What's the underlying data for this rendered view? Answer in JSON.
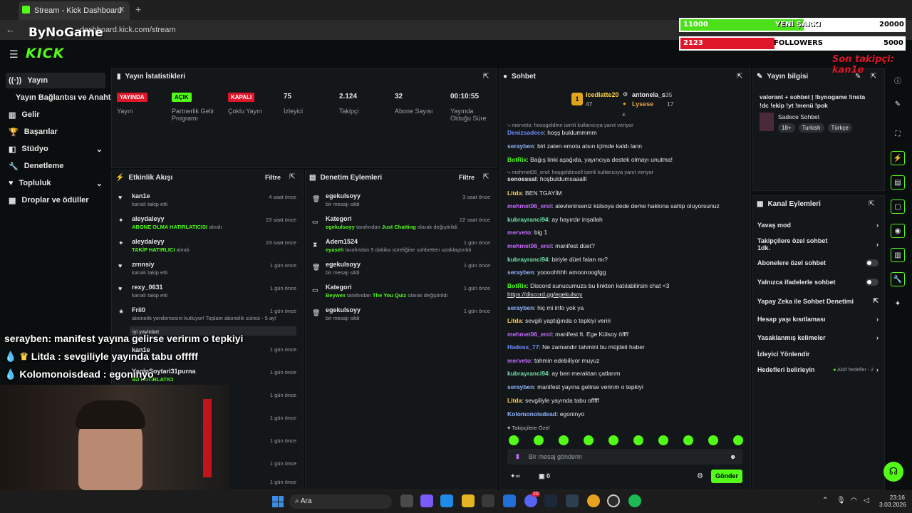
{
  "browser": {
    "tab_title": "Stream - Kick Dashboard",
    "url": "dashboard.kick.com/stream",
    "watermark": "ByNoGame"
  },
  "header": {
    "logo": "KICK"
  },
  "sidebar": {
    "items": [
      {
        "label": "Yayın",
        "icon": "broadcast-icon"
      },
      {
        "label": "Yayın Bağlantısı ve Anahtarı"
      },
      {
        "label": "Gelir",
        "icon": "chart-icon"
      },
      {
        "label": "Başarılar",
        "icon": "trophy-icon"
      },
      {
        "label": "Stüdyo",
        "icon": "layers-icon"
      },
      {
        "label": "Denetleme",
        "icon": "wrench-icon"
      },
      {
        "label": "Topluluk",
        "icon": "heart-icon"
      },
      {
        "label": "Droplar ve ödüller",
        "icon": "grid-icon"
      }
    ]
  },
  "stats": {
    "title": "Yayın İstatistikleri",
    "items": [
      {
        "badge": "YAYINDA",
        "label": "Yayın"
      },
      {
        "badge": "AÇIK",
        "label": "Partnerlik Gelir Programı"
      },
      {
        "badge": "KAPALI",
        "label": "Çoklu Yayın"
      },
      {
        "value": "75",
        "label": "İzleyici"
      },
      {
        "value": "2.124",
        "label": "Takipçi"
      },
      {
        "value": "32",
        "label": "Abone Sayısı"
      },
      {
        "value": "00:10:55",
        "label": "Yayında Olduğu Süre"
      }
    ]
  },
  "activity": {
    "title": "Etkinlik Akışı",
    "filter": "Filtre",
    "rows": [
      {
        "name": "kan1e",
        "sub": "kanalı takip etti",
        "time": "4 saat önce"
      },
      {
        "name": "aleydaleyy",
        "sub_hi": "ABONE OLMA HATIRLATICISI",
        "sub": "alındı",
        "time": "23 saat önce"
      },
      {
        "name": "aleydaleyy",
        "sub_hi": "TAKİP HATIRLICI",
        "sub": "alındı",
        "time": "23 saat önce"
      },
      {
        "name": "zrnnsiy",
        "sub": "kanalı takip etti",
        "time": "1 gün önce"
      },
      {
        "name": "rexy_0631",
        "sub": "kanalı takip etti",
        "time": "1 gün önce"
      },
      {
        "name": "Frii0",
        "sub": "abonelik yenilemesini kutluyor! Toplam abonelik süresi - 5 ay!",
        "time": "1 gün önce"
      },
      {
        "name": "kan1e",
        "sub": "",
        "time": "1 gün önce"
      },
      {
        "name": "YaginSoytari31purna",
        "sub_hi": "SU HATIRLATICI",
        "sub": "",
        "time": "1 gün önce"
      }
    ],
    "extra_times": [
      "1 gün önce",
      "1 gün önce",
      "1 gün önce",
      "1 gün önce",
      "1 gün önce"
    ],
    "tag": "iyi yayinlart"
  },
  "moderation": {
    "title": "Denetim Eylemleri",
    "filter": "Filtre",
    "rows": [
      {
        "name": "egekulsoyy",
        "sub": "bir mesajı sildi",
        "time": "3 saat önce"
      },
      {
        "name": "Kategori",
        "sub_user": "egekulsoyy",
        "sub_mid": "tarafından",
        "sub_hi": "Just Chatting",
        "sub_end": "olarak değiştirildi",
        "time": "22 saat önce"
      },
      {
        "name": "Adem1524",
        "sub_user": "eyaseh",
        "sub_mid": "tarafından 5 dakika süreliğine sohbetten uzaklaştırıldı",
        "time": "1 gün önce"
      },
      {
        "name": "egekulsoyy",
        "sub": "bir mesajı sildi",
        "time": "1 gün önce"
      },
      {
        "name": "Kategori",
        "sub_user": "Beywex",
        "sub_mid": "tarafından",
        "sub_hi": "The You Quiz",
        "sub_end": "olarak değiştirildi",
        "time": "1 gün önce"
      },
      {
        "name": "egekulsoyy",
        "sub": "bir mesajı sildi",
        "time": "1 gün önce"
      }
    ]
  },
  "chat": {
    "title": "Sohbet",
    "leaderboard": [
      {
        "name": "Icedlatte20",
        "count": "47",
        "rank": "1"
      },
      {
        "name": "antonela_s",
        "count": "35"
      },
      {
        "name": "Lysese",
        "count": "17"
      }
    ],
    "messages": [
      {
        "reply": "merveto: hossgeldinn isimli kullanıcıya yanıt veriyor"
      },
      {
        "user": "Denizsadece",
        "color": "#6f8cff",
        "text": "hoşş buldummmm"
      },
      {
        "user": "serayben",
        "color": "#8fb3ff",
        "text": "biri zaten emotu atsın içimde kaldı lann"
      },
      {
        "user": "BotRix",
        "color": "#53fc18",
        "text": "Bağış linki aşağıda, yayıncıya destek olmayı unutma!"
      },
      {
        "reply": "mehmet06_erol: hoşgeldinsell isimli kullanıcıya yanıt veriyor"
      },
      {
        "user": "senosssal",
        "color": "#e6e6e6",
        "text": "hoşbuldumsaaalll"
      },
      {
        "user": "Litda",
        "color": "#ffd24a",
        "text": "BEN TGAYİM"
      },
      {
        "user": "mehmet06_erol",
        "color": "#c66bff",
        "text": "alevlenirseniz külsoya dede deme hakkına sahip oluyorsunuz"
      },
      {
        "user": "kubrayranci94",
        "color": "#6fe3a5",
        "text": "ay hayırdır inşallah"
      },
      {
        "user": "merveto",
        "color": "#c66bff",
        "text": "big 1"
      },
      {
        "user": "mehmet06_erol",
        "color": "#c66bff",
        "text": "manifest düet?"
      },
      {
        "user": "kubrayranci94",
        "color": "#6fe3a5",
        "text": "biriyle düet falan mı?"
      },
      {
        "user": "serayben",
        "color": "#8fb3ff",
        "text": "yoooohhhh amoonoogfgg"
      },
      {
        "user": "BotRix",
        "color": "#53fc18",
        "text": "Discord sunucumuza bu linkten katılabilirsin chat <3"
      },
      {
        "link": "https://discord.gg/egekulsoy"
      },
      {
        "user": "serayben",
        "color": "#8fb3ff",
        "text": "hiç mi info yok ya"
      },
      {
        "user": "Litda",
        "color": "#ffd24a",
        "text": "sevgili yaptığında o tepkiyi veriri"
      },
      {
        "user": "mehmet06_erol",
        "color": "#c66bff",
        "text": "manifest ft. Ege Külsoy öffff"
      },
      {
        "user": "Hadess_77",
        "color": "#6f8cff",
        "text": "Ne zamandır tahmini bu müjdeli haber"
      },
      {
        "user": "merveto",
        "color": "#c66bff",
        "text": "tahmin edebiliyor muyuz"
      },
      {
        "user": "kubrayranci94",
        "color": "#6fe3a5",
        "text": "ay ben meraktan çatlarım"
      },
      {
        "user": "serayben",
        "color": "#8fb3ff",
        "text": "manifest yayına gelirse verirım o tepkiyi"
      },
      {
        "user": "Litda",
        "color": "#ffd24a",
        "text": "sevgiliyle yayında tabu offfff"
      },
      {
        "user": "Kolomonoisdead",
        "color": "#8fb3ff",
        "text": "egoninyo"
      }
    ],
    "followers_label": "Takipçilere Özel",
    "input_placeholder": "Bir mesaj gönderin",
    "counter": "0",
    "infinite": "∞",
    "send": "Gönder"
  },
  "stream_info": {
    "title": "Yayın bilgisi",
    "text": "valorant + sohbet | !bynogame !insta !dc !ekip !yt !menü !pok",
    "category": "Sadece Sohbet",
    "tags": [
      "18+",
      "Turkish",
      "Türkçe"
    ]
  },
  "channel_actions": {
    "title": "Kanal Eylemleri",
    "items": [
      {
        "label": "Yavaş mod",
        "type": "arrow"
      },
      {
        "label": "Takipçilere özel sohbet",
        "sub": "1dk.",
        "type": "arrow"
      },
      {
        "label": "Abonelere özel sohbet",
        "type": "toggle"
      },
      {
        "label": "Yalnızca ifadelerle sohbet",
        "type": "toggle"
      },
      {
        "label": "Yapay Zeka ile Sohbet Denetimi",
        "type": "ext"
      },
      {
        "label": "Hesap yaşı kısıtlaması",
        "type": "arrow"
      },
      {
        "label": "Yasaklanmış kelimeler",
        "type": "arrow"
      },
      {
        "label": "İzleyici Yönlendir",
        "type": "none"
      },
      {
        "label": "Hedefleri belirleyin",
        "hint": "Aktif hedefler - 2",
        "type": "arrow"
      }
    ]
  },
  "overlay": {
    "subs_current": "11000",
    "subs_label": "YENİ ŞARKI",
    "subs_target": "20000",
    "subs_fill": 0.55,
    "foll_current": "2123",
    "foll_label": "FOLLOWERS",
    "foll_target": "5000",
    "foll_fill": 0.42,
    "last_follower": "Son takipçi: kan1e",
    "chat": [
      {
        "user": "serayben",
        "text": ": manifest yayına gelirse verirım o tepkiyi"
      },
      {
        "user": "Litda",
        "text": ": sevgiliyle yayında tabu offfff"
      },
      {
        "user": "Kolomonoisdead",
        "text": ": egoninyo"
      }
    ]
  },
  "taskbar": {
    "search": "Ara",
    "time": "23:16",
    "date": "3.03.2026",
    "badge": "20"
  },
  "colors": {
    "accent": "#53fc18",
    "live": "#e0162b"
  }
}
